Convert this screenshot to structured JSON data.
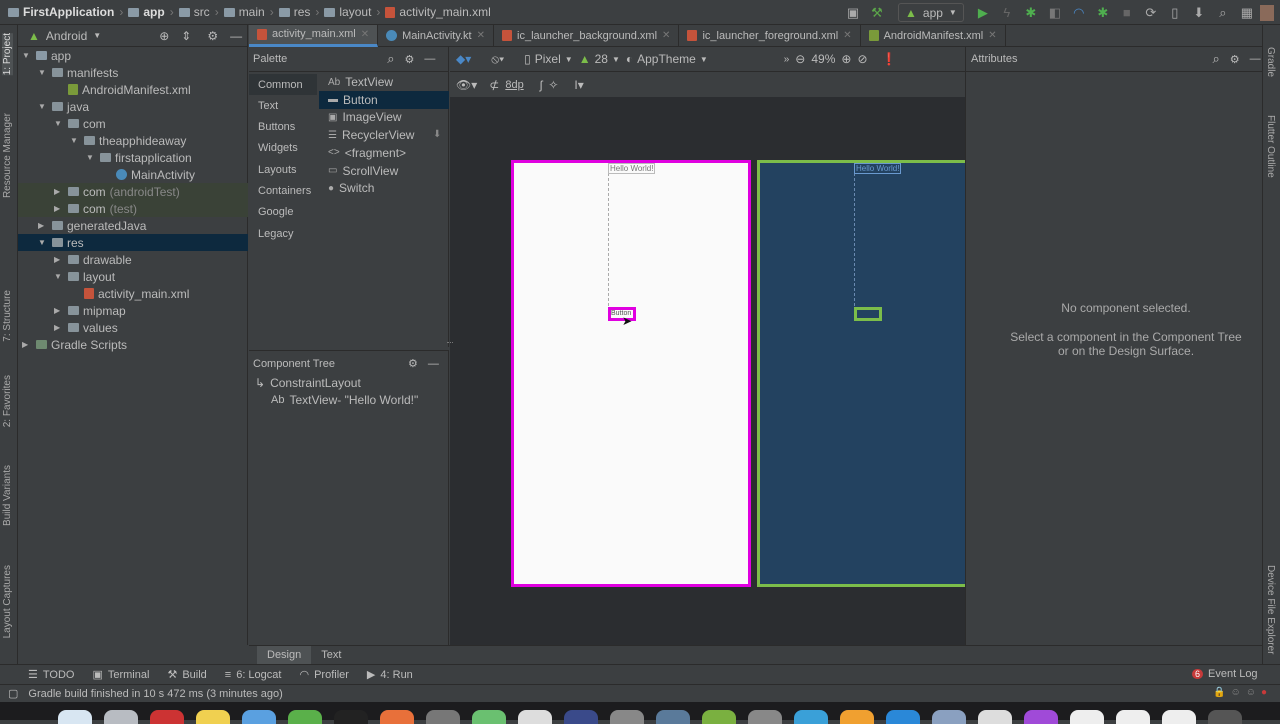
{
  "breadcrumb": [
    "FirstApplication",
    "app",
    "src",
    "main",
    "res",
    "layout",
    "activity_main.xml"
  ],
  "run_config": "app",
  "left_strip": [
    "1: Project",
    "Resource Manager",
    "7: Structure",
    "2: Favorites",
    "Build Variants",
    "Layout Captures"
  ],
  "right_strip": [
    "Gradle",
    "Flutter Outline",
    "Device File Explorer"
  ],
  "project": {
    "view_selector": "Android",
    "tree": [
      {
        "label": "app",
        "depth": 0,
        "open": true,
        "icon": "module"
      },
      {
        "label": "manifests",
        "depth": 1,
        "open": true,
        "icon": "folder"
      },
      {
        "label": "AndroidManifest.xml",
        "depth": 2,
        "icon": "manifest"
      },
      {
        "label": "java",
        "depth": 1,
        "open": true,
        "icon": "folder"
      },
      {
        "label": "com",
        "depth": 2,
        "open": true,
        "icon": "folder"
      },
      {
        "label": "theapphideaway",
        "depth": 3,
        "open": true,
        "icon": "folder"
      },
      {
        "label": "firstapplication",
        "depth": 4,
        "open": true,
        "icon": "folder"
      },
      {
        "label": "MainActivity",
        "depth": 5,
        "icon": "kotlin"
      },
      {
        "label": "com",
        "suffix": "(androidTest)",
        "depth": 2,
        "open": false,
        "icon": "folder"
      },
      {
        "label": "com",
        "suffix": "(test)",
        "depth": 2,
        "open": false,
        "icon": "folder"
      },
      {
        "label": "generatedJava",
        "depth": 1,
        "open": false,
        "icon": "folder"
      },
      {
        "label": "res",
        "depth": 1,
        "open": true,
        "icon": "folder",
        "selected": true
      },
      {
        "label": "drawable",
        "depth": 2,
        "open": false,
        "icon": "folder"
      },
      {
        "label": "layout",
        "depth": 2,
        "open": true,
        "icon": "folder"
      },
      {
        "label": "activity_main.xml",
        "depth": 3,
        "icon": "xml"
      },
      {
        "label": "mipmap",
        "depth": 2,
        "open": false,
        "icon": "folder"
      },
      {
        "label": "values",
        "depth": 2,
        "open": false,
        "icon": "folder"
      },
      {
        "label": "Gradle Scripts",
        "depth": 0,
        "open": false,
        "icon": "gradle"
      }
    ]
  },
  "editor_tabs": [
    {
      "label": "activity_main.xml",
      "icon": "xml",
      "active": true
    },
    {
      "label": "MainActivity.kt",
      "icon": "kotlin"
    },
    {
      "label": "ic_launcher_background.xml",
      "icon": "xml"
    },
    {
      "label": "ic_launcher_foreground.xml",
      "icon": "xml"
    },
    {
      "label": "AndroidManifest.xml",
      "icon": "manifest"
    }
  ],
  "palette": {
    "title": "Palette",
    "categories": [
      "Common",
      "Text",
      "Buttons",
      "Widgets",
      "Layouts",
      "Containers",
      "Google",
      "Legacy"
    ],
    "items": [
      {
        "icon": "Ab",
        "label": "TextView"
      },
      {
        "icon": "▬",
        "label": "Button"
      },
      {
        "icon": "▣",
        "label": "ImageView"
      },
      {
        "icon": "☰",
        "label": "RecyclerView"
      },
      {
        "icon": "<>",
        "label": "<fragment>"
      },
      {
        "icon": "▭",
        "label": "ScrollView"
      },
      {
        "icon": "●",
        "label": "Switch"
      }
    ]
  },
  "component_tree": {
    "title": "Component Tree",
    "root": "ConstraintLayout",
    "child_icon": "Ab",
    "child": "TextView- \"Hello World!\""
  },
  "design_toolbar": {
    "device": "Pixel",
    "api": "28",
    "theme": "AppTheme",
    "zoom": "49%",
    "margin": "8dp"
  },
  "canvas": {
    "textview": "Hello World!",
    "button": "Button",
    "design_border": "#e000e0",
    "blueprint_border": "#7cbd4a",
    "blueprint_bg": "#234260"
  },
  "attributes": {
    "title": "Attributes",
    "empty_title": "No component selected.",
    "empty_hint": "Select a component in the Component Tree or on the Design Surface."
  },
  "design_tabs": [
    "Design",
    "Text"
  ],
  "tool_windows": [
    {
      "icon": "☰",
      "label": "TODO"
    },
    {
      "icon": "▣",
      "label": "Terminal"
    },
    {
      "icon": "⚒",
      "label": "Build"
    },
    {
      "icon": "≡",
      "label": "6: Logcat"
    },
    {
      "icon": "◠",
      "label": "Profiler"
    },
    {
      "icon": "▶",
      "label": "4: Run"
    }
  ],
  "event_log": {
    "count": "6",
    "label": "Event Log"
  },
  "status": "Gradle build finished in 10 s 472 ms (3 minutes ago)"
}
